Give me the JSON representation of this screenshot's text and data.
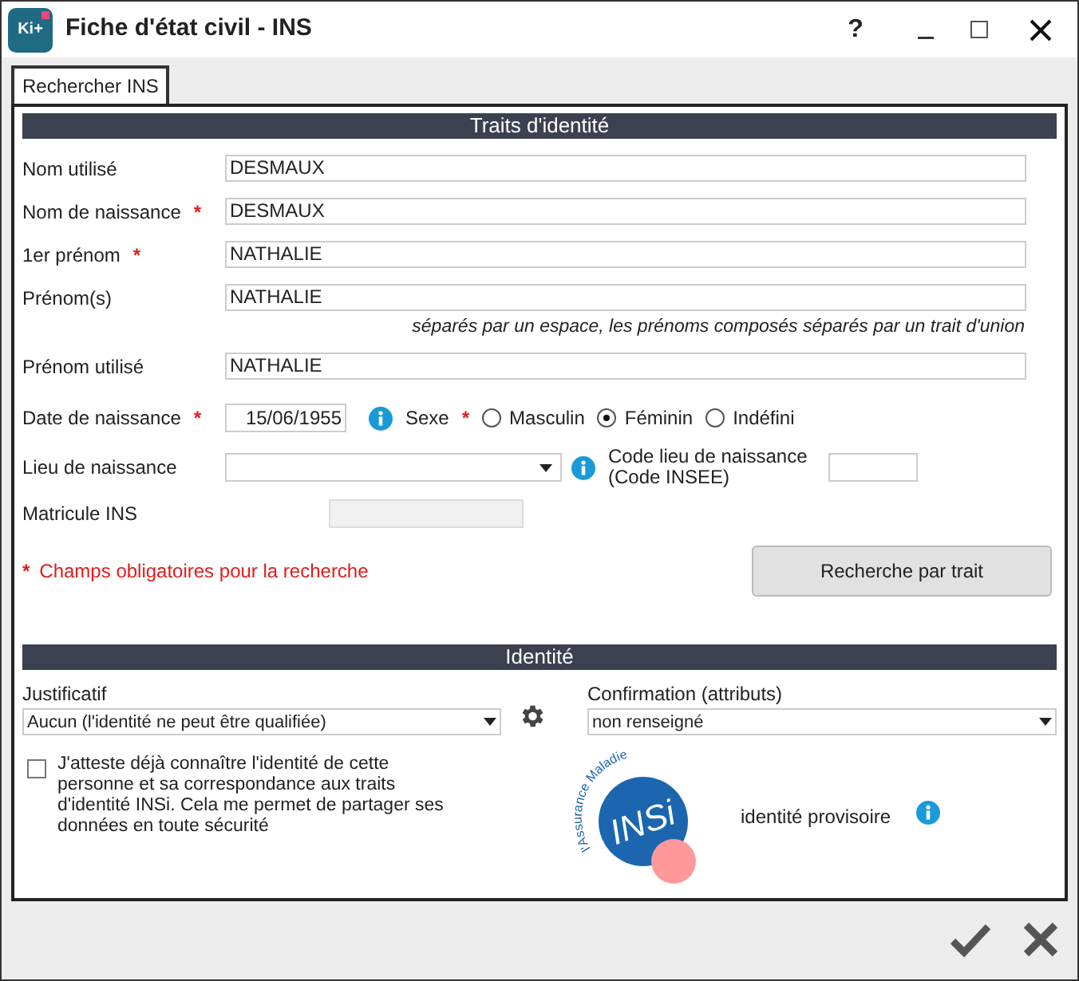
{
  "window": {
    "app_icon": "Ki+",
    "title": "Fiche d'état civil - INS",
    "help": "?"
  },
  "tabs": [
    {
      "label": "Rechercher INS",
      "selected": true
    }
  ],
  "traits": {
    "header": "Traits d'identité",
    "fields": [
      {
        "label": "Nom utilisé",
        "required": false,
        "value": "DESMAUX"
      },
      {
        "label": "Nom de naissance",
        "required": true,
        "value": "DESMAUX"
      },
      {
        "label": "1er prénom",
        "required": true,
        "value": "NATHALIE"
      },
      {
        "label": "Prénom(s)",
        "required": false,
        "value": "NATHALIE",
        "hint": "séparés par un espace, les prénoms composés séparés par un trait d'union"
      },
      {
        "label": "Prénom utilisé",
        "required": false,
        "value": "NATHALIE"
      }
    ],
    "birth_date": {
      "label": "Date de naissance",
      "required": true,
      "value": "15/06/1955"
    },
    "sex": {
      "label": "Sexe",
      "required": true,
      "options": [
        {
          "label": "Masculin",
          "selected": false
        },
        {
          "label": "Féminin",
          "selected": true
        },
        {
          "label": "Indéfini",
          "selected": false
        }
      ]
    },
    "birth_place": {
      "label": "Lieu de naissance"
    },
    "birth_code": {
      "label": "Code lieu de naissance (Code INSEE)"
    },
    "matricule": {
      "label": "Matricule INS",
      "disabled": true
    },
    "required_note": {
      "mark": "*",
      "text": "Champs obligatoires pour la recherche"
    },
    "search_button": "Recherche par trait"
  },
  "identity": {
    "header": "Identité",
    "justificatif": {
      "label": "Justificatif",
      "value": "Aucun (l'identité ne peut être qualifiée)"
    },
    "confirmation": {
      "label": "Confirmation (attributs)",
      "value": "non renseigné"
    },
    "attest": {
      "checked": false,
      "text": "J'atteste déjà connaître l'identité de cette personne et sa correspondance aux traits d'identité INSi. Cela me permet de partager ses données en toute sécurité"
    },
    "logo": {
      "arc_text": "l'Assurance Maladie",
      "main_text": "INSi"
    },
    "status": "identité provisoire"
  }
}
